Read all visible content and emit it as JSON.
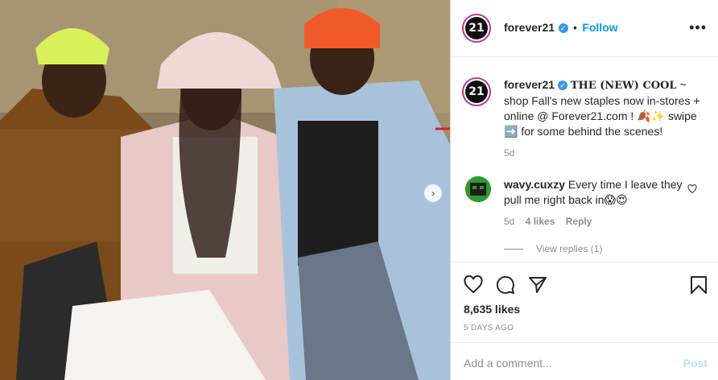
{
  "post": {
    "account": "forever21",
    "avatar_text": "21",
    "follow_label": "Follow",
    "more_label": "•••",
    "caption": {
      "username": "forever21",
      "headline": "THE (NEW) COOL",
      "line1": " ~ shop Fall's new staples now in-stores + online @ Forever21.com ! 🍂✨",
      "line2": "swipe ➡️ for some behind the scenes!",
      "age": "5d"
    },
    "comment": {
      "username": "wavy.cuxzy",
      "text": "Every time I leave they pull me right back in😱😍",
      "age": "5d",
      "likes": "4 likes",
      "reply": "Reply",
      "view_replies": "View replies (1)"
    },
    "likes": "8,635 likes",
    "date": "5 DAYS AGO",
    "add_comment_placeholder": "Add a comment...",
    "post_label": "Post"
  },
  "colors": {
    "accent": "#0095f6",
    "annotation_arrow": "#e0201b",
    "muted": "#8e8e8e"
  },
  "icons": [
    "more-icon",
    "verified-icon",
    "heart-icon",
    "comment-icon",
    "share-icon",
    "bookmark-icon",
    "carousel-next-icon"
  ]
}
